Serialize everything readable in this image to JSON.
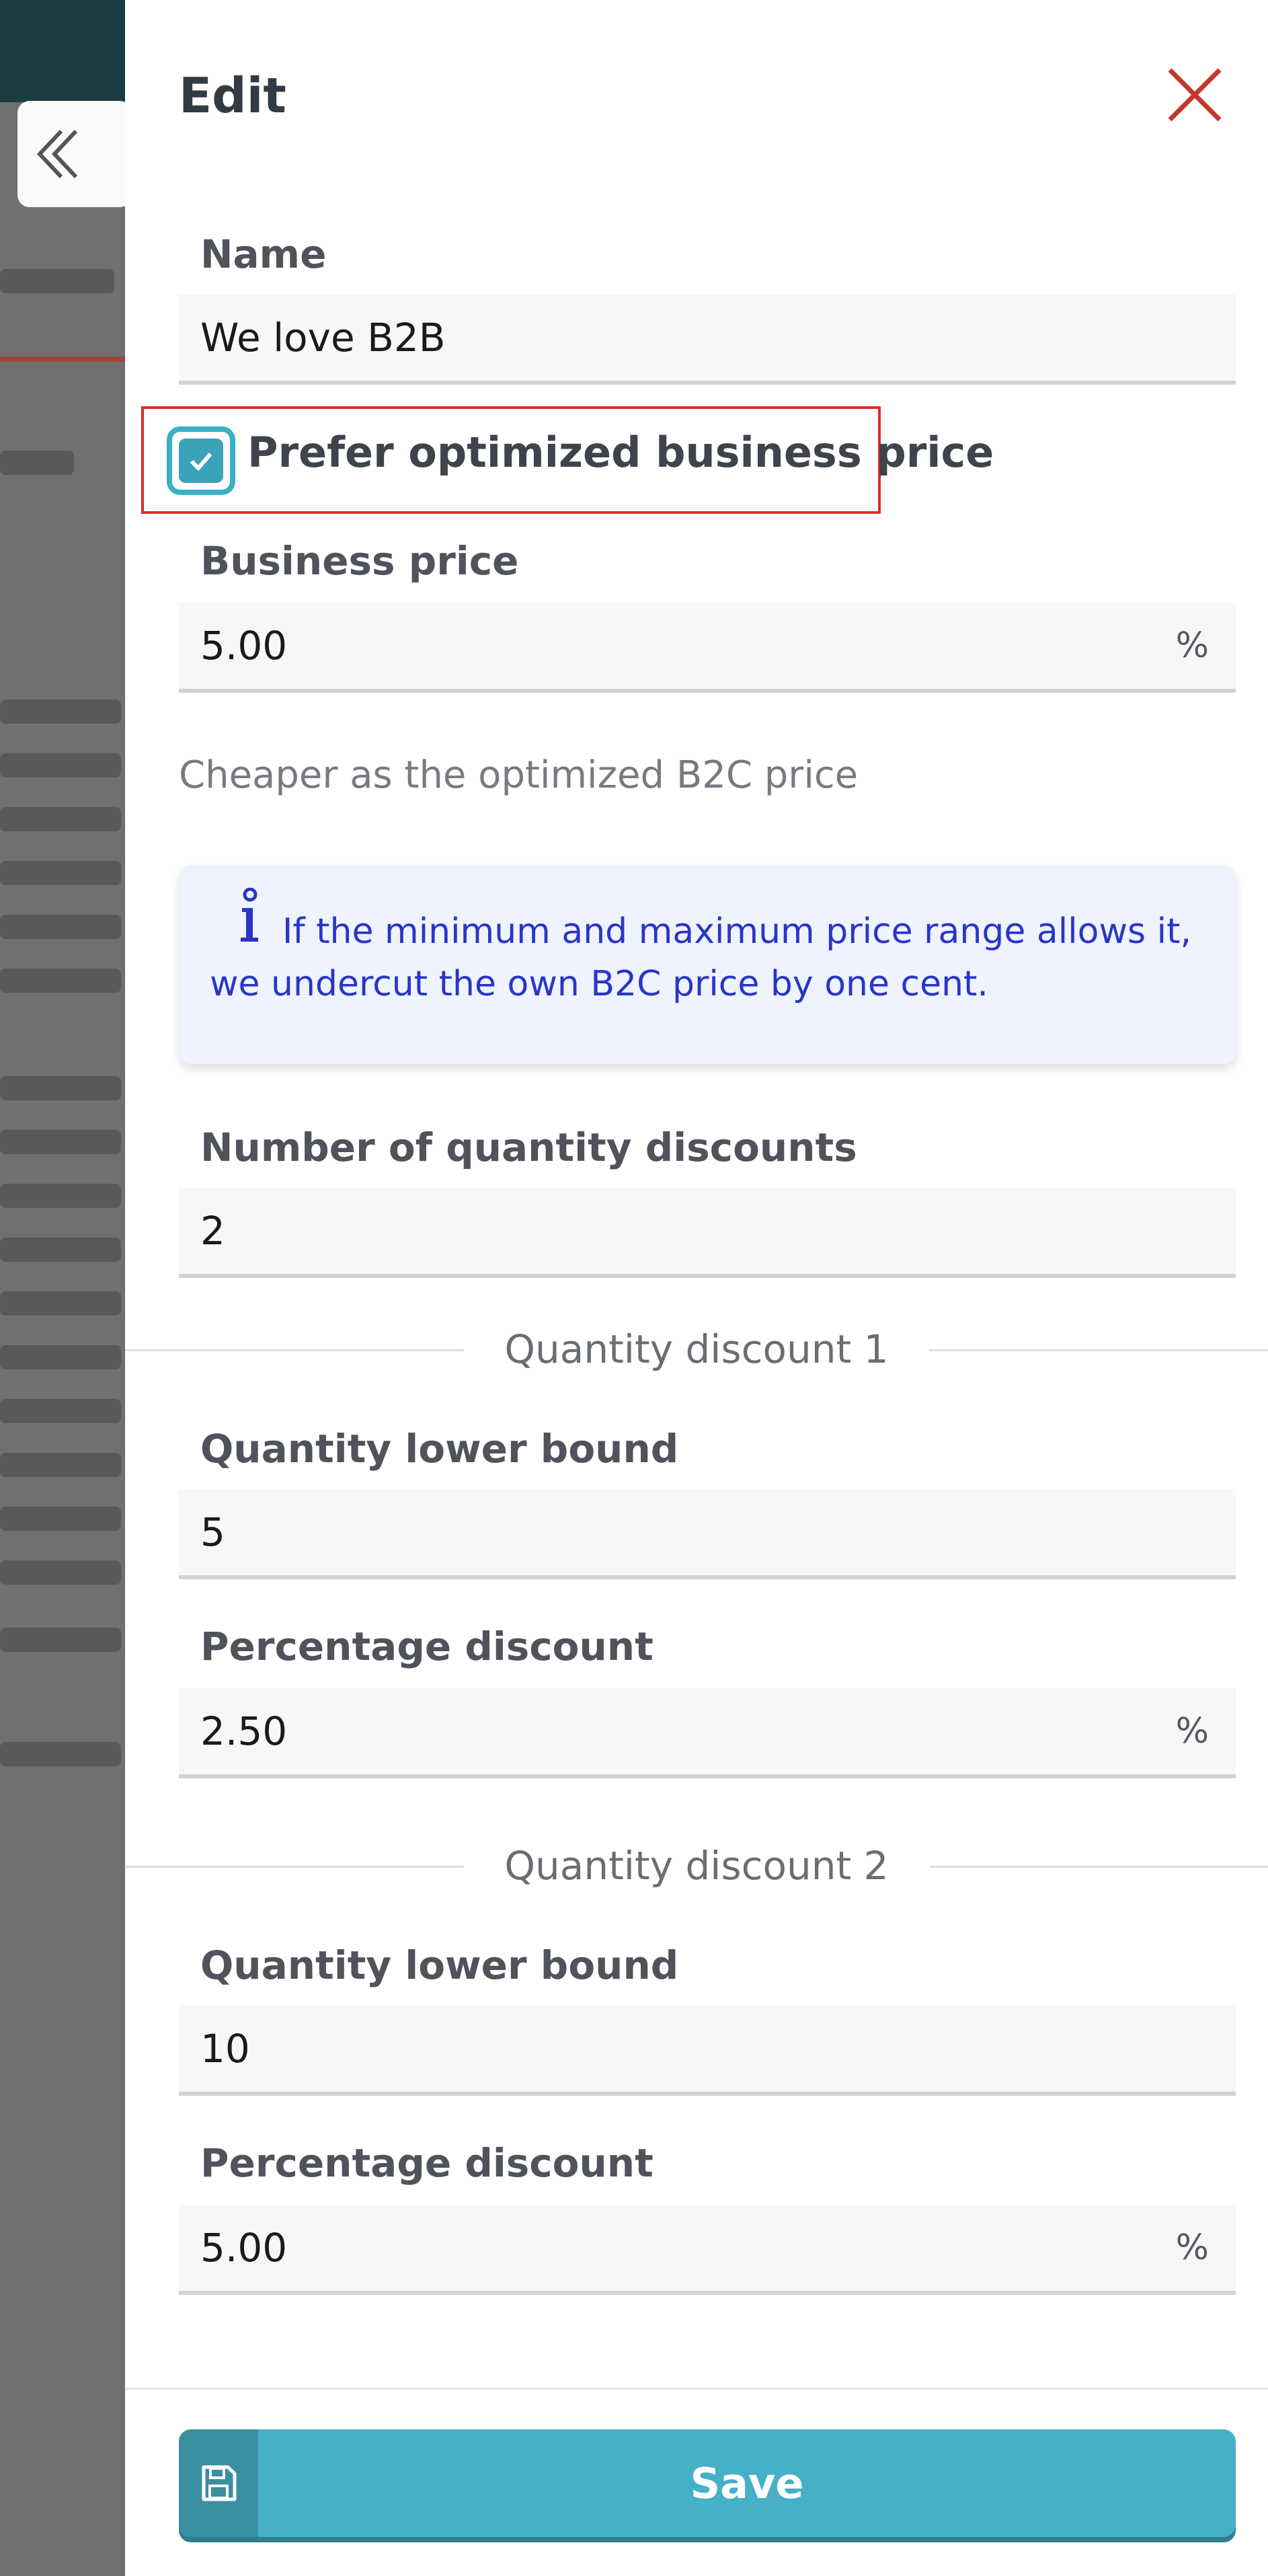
{
  "header": {
    "title": "Edit"
  },
  "name_field": {
    "label": "Name",
    "value": "We love B2B"
  },
  "prefer_optimized": {
    "label": "Prefer optimized business price",
    "checked": true
  },
  "business_price": {
    "label": "Business price",
    "value": "5.00",
    "unit": "%"
  },
  "help_text": "Cheaper as the optimized B2C price",
  "info": {
    "icon": "info-icon",
    "text": "If the minimum and maximum price range allows it, we undercut the own B2C price by one cent."
  },
  "quantity_discount_count": {
    "label": "Number of quantity discounts",
    "value": "2"
  },
  "discounts": [
    {
      "title": "Quantity discount 1",
      "lower_bound_label": "Quantity lower bound",
      "lower_bound": "5",
      "percentage_label": "Percentage discount",
      "percentage": "2.50",
      "unit": "%"
    },
    {
      "title": "Quantity discount 2",
      "lower_bound_label": "Quantity lower bound",
      "lower_bound": "10",
      "percentage_label": "Percentage discount",
      "percentage": "5.00",
      "unit": "%"
    }
  ],
  "footer": {
    "save_label": "Save",
    "save_icon": "floppy-disk-icon"
  },
  "colors": {
    "accent": "#46b0c6",
    "close": "#c0392b",
    "info_text": "#2a35c7",
    "highlight": "#de2b2b"
  }
}
